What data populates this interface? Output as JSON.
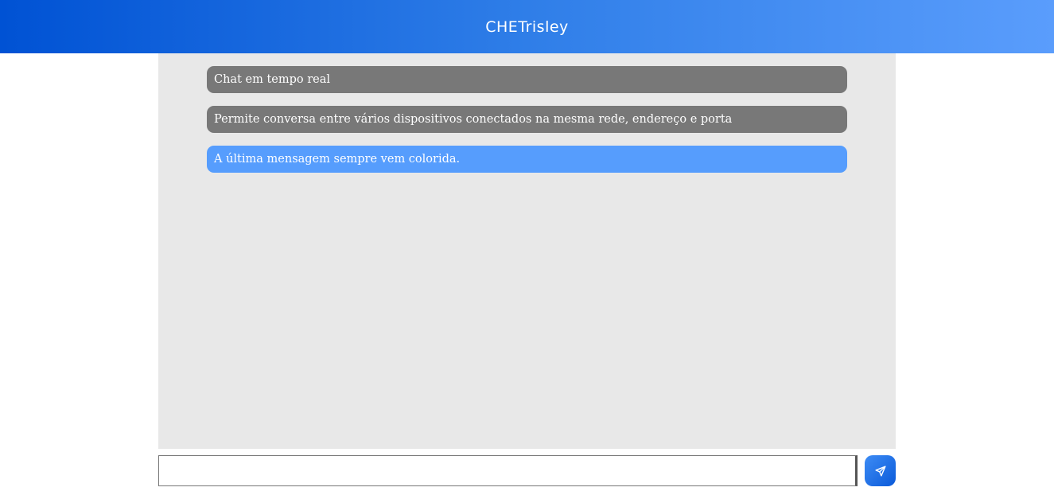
{
  "header": {
    "title": "CHETrisley"
  },
  "chat": {
    "messages": [
      {
        "text": "Chat em tempo real",
        "style": "gray"
      },
      {
        "text": "Permite conversa entre vários dispositivos conectados na mesma rede, endereço e porta",
        "style": "gray"
      },
      {
        "text": "A última mensagem sempre vem colorida.",
        "style": "highlighted"
      }
    ]
  },
  "composer": {
    "input_value": "",
    "send_icon": "paper-plane-icon"
  },
  "colors": {
    "header_gradient_start": "#0052d4",
    "header_gradient_end": "#5a9dfc",
    "chat_background": "#e8e8e8",
    "message_gray": "#787878",
    "message_highlight": "#569dfd",
    "send_button": "#1e6ee6"
  }
}
